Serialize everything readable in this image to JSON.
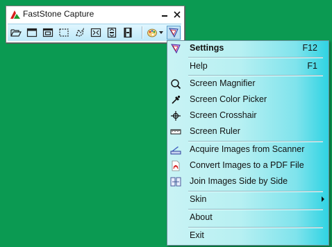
{
  "app": {
    "title": "FastStone Capture",
    "controls": {
      "minimize_icon": "minimize-icon",
      "close_icon": "close-icon"
    }
  },
  "toolbar": {
    "buttons": [
      {
        "name": "open-file-icon"
      },
      {
        "name": "capture-active-window-icon"
      },
      {
        "name": "capture-window-object-icon"
      },
      {
        "name": "capture-rectangular-region-icon"
      },
      {
        "name": "capture-freehand-region-icon"
      },
      {
        "name": "capture-full-screen-icon"
      },
      {
        "name": "capture-scrolling-window-icon"
      },
      {
        "name": "screen-recorder-icon"
      },
      {
        "name": "output-palette-icon"
      },
      {
        "name": "settings-menu-icon"
      }
    ]
  },
  "menu": {
    "items": [
      {
        "id": "settings",
        "label": "Settings",
        "shortcut": "F12",
        "bold": true,
        "icon": "settings-icon"
      },
      {
        "id": "help",
        "label": "Help",
        "shortcut": "F1"
      },
      {
        "id": "screen-magnifier",
        "label": "Screen Magnifier",
        "icon": "magnifier-icon"
      },
      {
        "id": "screen-color-picker",
        "label": "Screen Color Picker",
        "icon": "eyedropper-icon"
      },
      {
        "id": "screen-crosshair",
        "label": "Screen Crosshair",
        "icon": "crosshair-icon"
      },
      {
        "id": "screen-ruler",
        "label": "Screen Ruler",
        "icon": "ruler-icon"
      },
      {
        "id": "acquire-images",
        "label": "Acquire Images from Scanner",
        "icon": "scanner-icon"
      },
      {
        "id": "convert-pdf",
        "label": "Convert Images to a PDF File",
        "icon": "pdf-icon"
      },
      {
        "id": "join-images",
        "label": "Join Images Side by Side",
        "icon": "join-images-icon"
      },
      {
        "id": "skin",
        "label": "Skin",
        "submenu": true
      },
      {
        "id": "about",
        "label": "About"
      },
      {
        "id": "exit",
        "label": "Exit"
      }
    ]
  },
  "colors": {
    "desktop": "#0b9a52",
    "menu_gradient_start": "#c9f3f4",
    "menu_gradient_end": "#2fd3e3",
    "toolbar_strip": "#dff6ff"
  }
}
